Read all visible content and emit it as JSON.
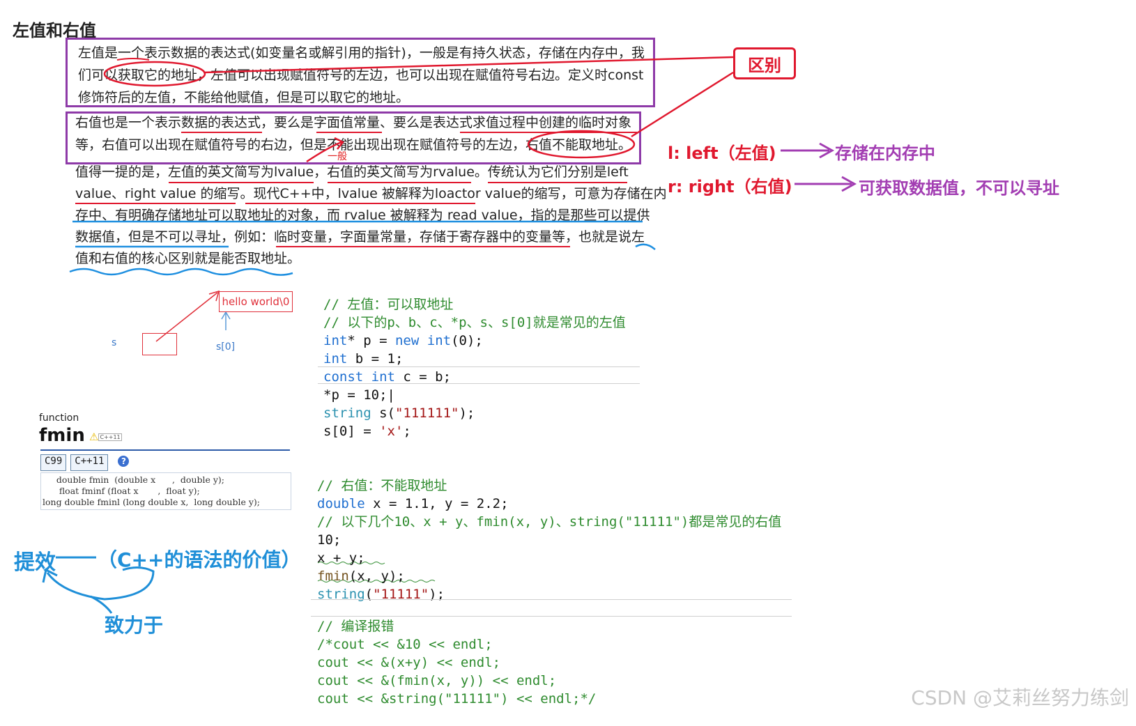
{
  "title": "左值和右值",
  "lvalue_paragraph": [
    "左值是一个表示数据的表达式(如变量名或解引用的指针)，一般是有持久状态，存储在内存中，我",
    "们可以获取它的地址，左值可以出现赋值符号的左边，也可以出现在赋值符号右边。定义时const",
    "修饰符后的左值，不能给他赋值，但是可以取它的地址。"
  ],
  "rvalue_paragraph": [
    "右值也是一个表示数据的表达式，要么是字面值常量、要么是表达式求值过程中创建的临时对象",
    "等，右值可以出现在赋值符号的右边，但是不能出现出现在赋值符号的左边，右值不能取地址。"
  ],
  "note_paragraph": [
    "值得一提的是，左值的英文简写为lvalue，右值的英文简写为rvalue。传统认为它们分别是left",
    "value、right value 的缩写。现代C++中，lvalue 被解释为loactor value的缩写，可意为存储在内",
    "存中、有明确存储地址可以取地址的对象，而 rvalue 被解释为 read value，指的是那些可以提供",
    "数据值，但是不可以寻址，例如：临时变量，字面量常量，存储于寄存器中的变量等，也就是说左",
    "值和右值的核心区别就是能否取地址。"
  ],
  "annotations": {
    "difference_label": "区别",
    "general_label": "一般",
    "l_key": "l:  left（左值)",
    "l_value": "存储在内存中",
    "r_key": "r:  right（右值)",
    "r_value": "可获取数据值，不可以寻址"
  },
  "diagram": {
    "hello_label": "hello world\\0",
    "s_label": "s",
    "s0_label": "s[0]"
  },
  "code_lvalue": [
    "// 左值：可以取地址",
    "// 以下的p、b、c、*p、s、s[0]就是常见的左值",
    "int* p = new int(0);",
    "int b = 1;",
    "const int c = b;",
    "*p = 10;",
    "string s(\"111111\");",
    "s[0] = 'x';"
  ],
  "code_rvalue": [
    "// 右值：不能取地址",
    "double x = 1.1, y = 2.2;",
    "// 以下几个10、x + y、fmin(x, y)、string(\"11111\")都是常见的右值",
    "10;",
    "x + y;",
    "fmin(x, y);",
    "string(\"11111\");"
  ],
  "code_error": [
    "// 编译报错",
    "/*cout << &10 << endl;",
    "cout << &(x+y) << endl;",
    "cout << &(fmin(x, y)) << endl;",
    "cout << &string(\"11111\") << endl;*/"
  ],
  "reference": {
    "kind": "function",
    "name": "fmin",
    "badge": "C++11",
    "tabs": [
      "C99",
      "C++11"
    ],
    "help": "?",
    "signatures": [
      "     double fmin  (double x      ,  double y);",
      "      float fminf (float x       ,  float y);",
      "long double fminl (long double x,  long double y);"
    ]
  },
  "handwriting": {
    "efficiency": "提效",
    "cpp_value": "（C++的语法的价值）",
    "committed": "致力于"
  },
  "watermark": "CSDN @艾莉丝努力练剑"
}
